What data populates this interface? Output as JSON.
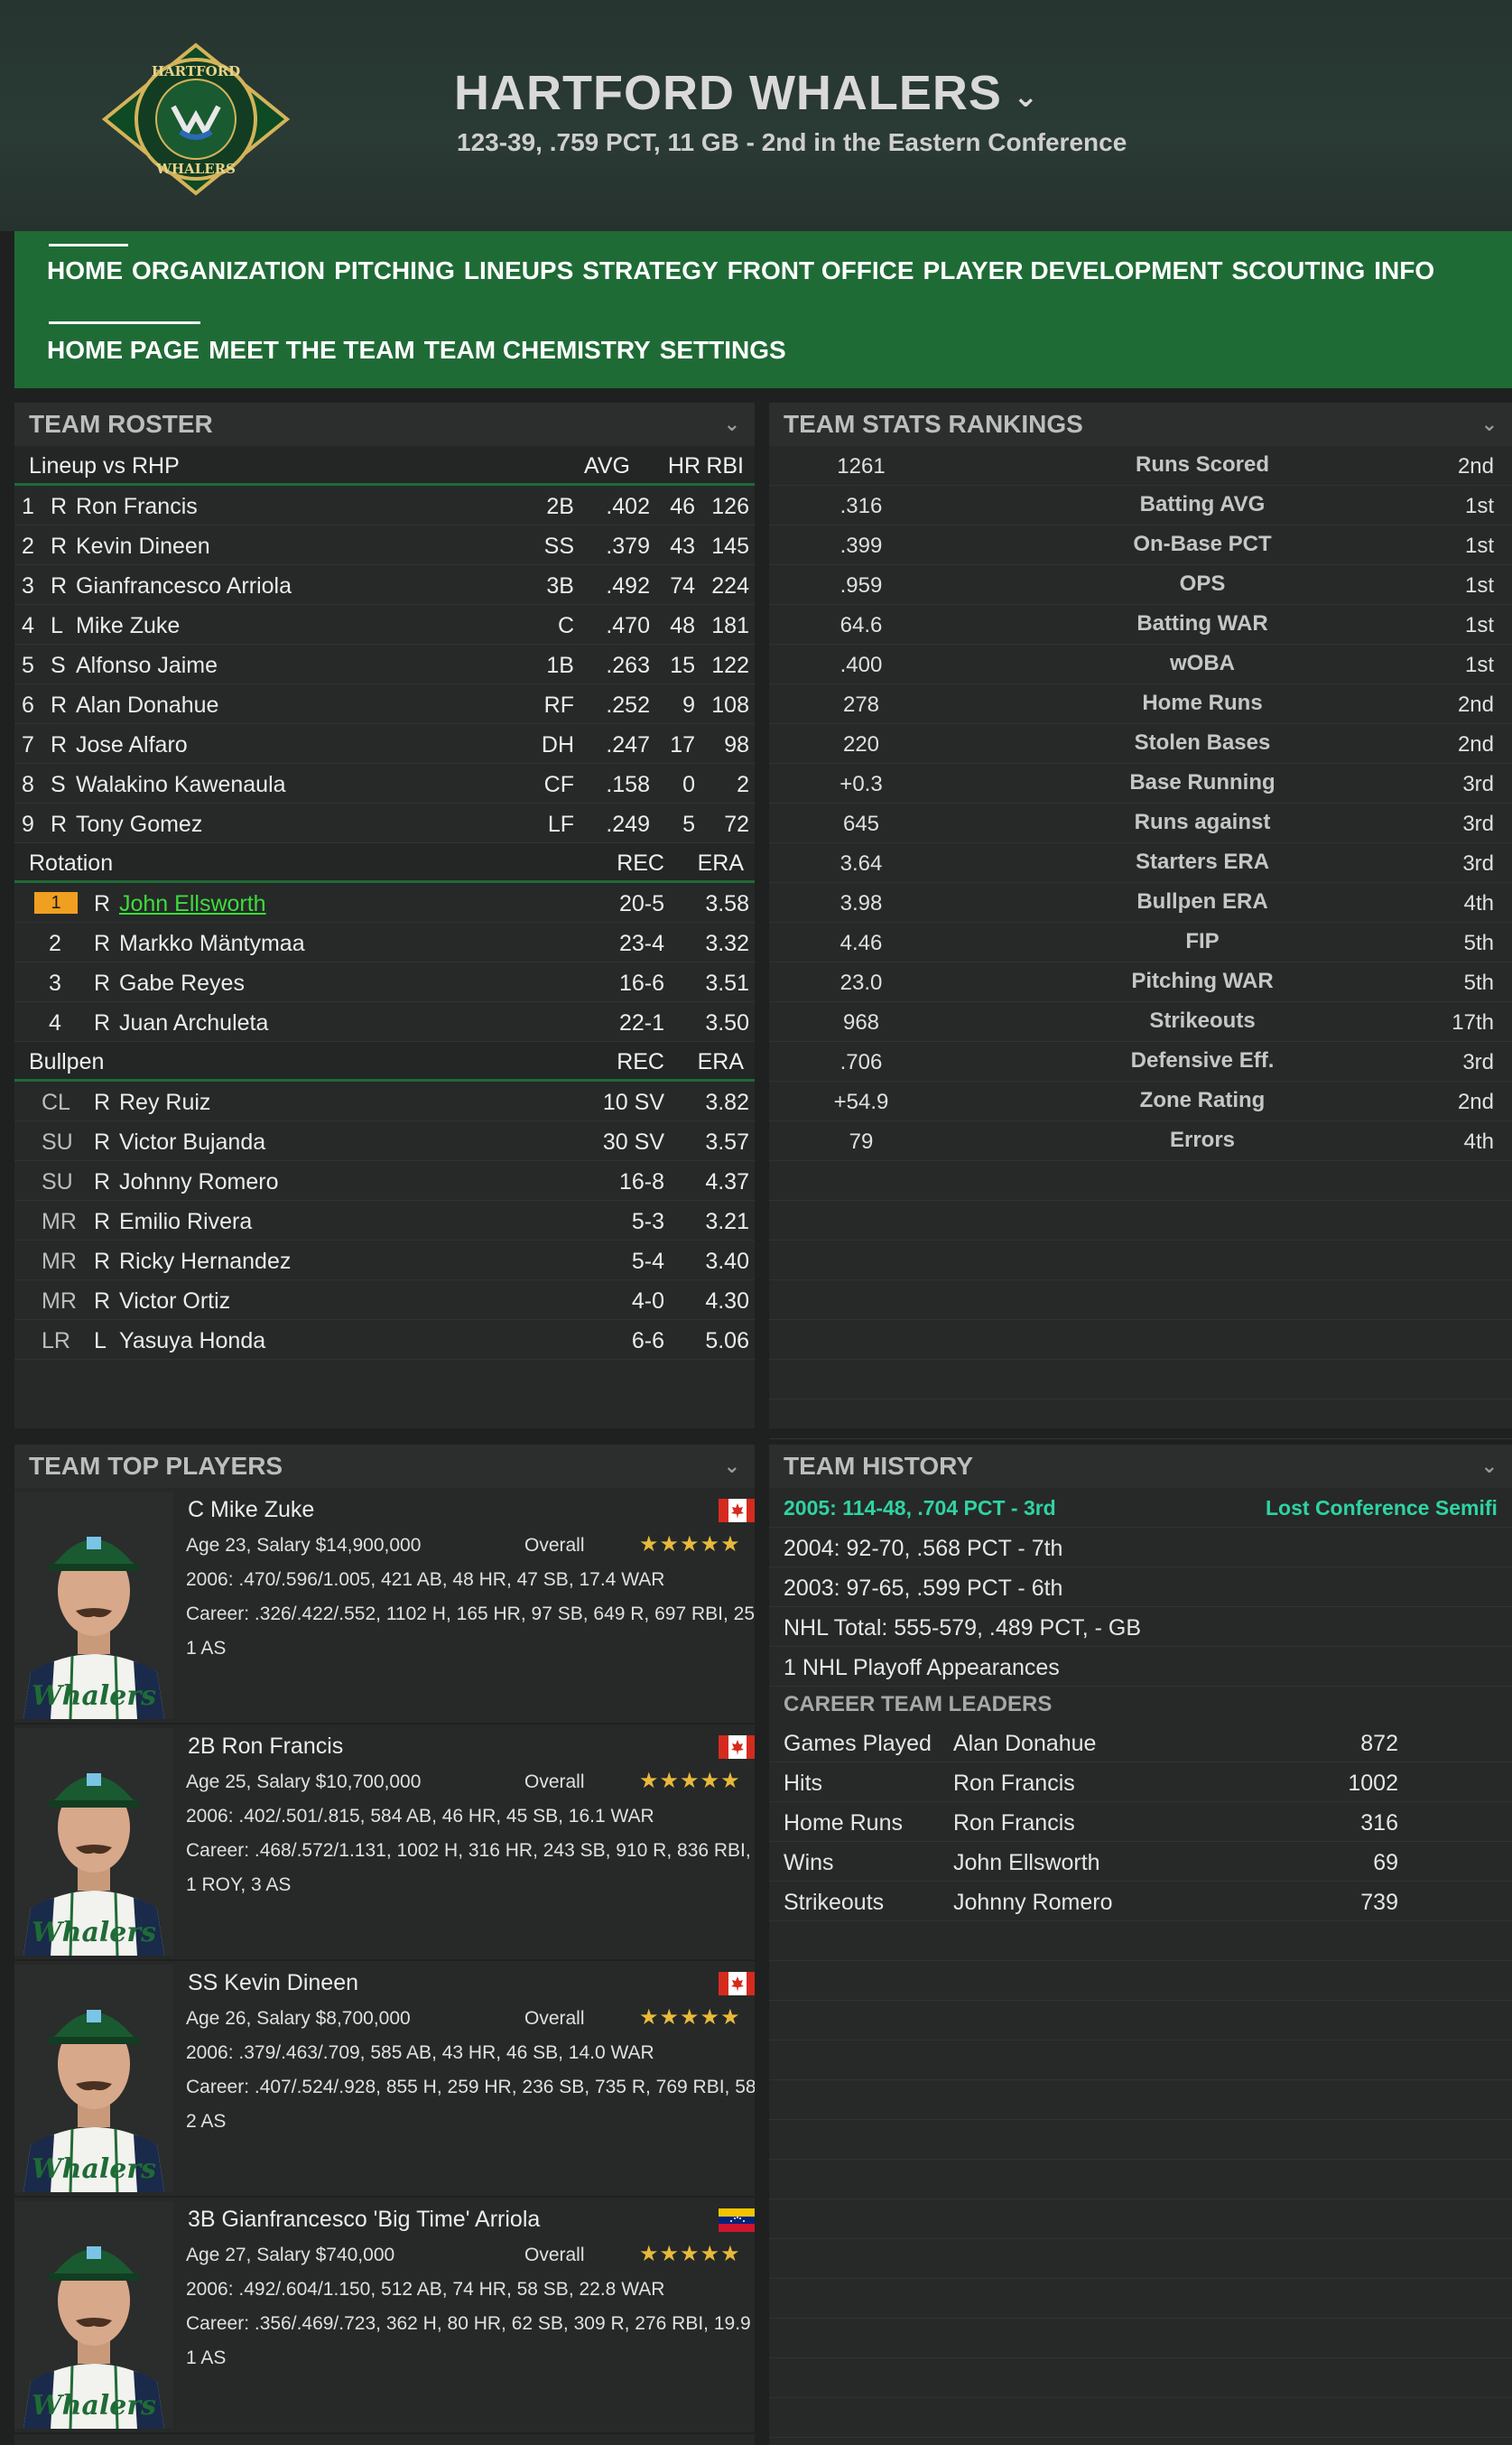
{
  "team": {
    "name": "HARTFORD WHALERS",
    "subtitle": "123-39, .759 PCT, 11 GB - 2nd in the Eastern Conference",
    "logo_text_top": "HARTFORD",
    "logo_text_bottom": "WHALERS"
  },
  "nav": {
    "main": [
      "HOME",
      "ORGANIZATION",
      "PITCHING",
      "LINEUPS",
      "STRATEGY",
      "FRONT OFFICE",
      "PLAYER DEVELOPMENT",
      "SCOUTING",
      "INFO"
    ],
    "sub": [
      "HOME PAGE",
      "MEET THE TEAM",
      "TEAM CHEMISTRY",
      "SETTINGS"
    ]
  },
  "roster": {
    "title": "TEAM ROSTER",
    "lineup_header": {
      "label": "Lineup vs RHP",
      "avg": "AVG",
      "hr": "HR",
      "rbi": "RBI"
    },
    "lineup": [
      {
        "n": "1",
        "hand": "R",
        "name": "Ron Francis",
        "pos": "2B",
        "avg": ".402",
        "hr": "46",
        "rbi": "126"
      },
      {
        "n": "2",
        "hand": "R",
        "name": "Kevin Dineen",
        "pos": "SS",
        "avg": ".379",
        "hr": "43",
        "rbi": "145"
      },
      {
        "n": "3",
        "hand": "R",
        "name": "Gianfrancesco Arriola",
        "pos": "3B",
        "avg": ".492",
        "hr": "74",
        "rbi": "224"
      },
      {
        "n": "4",
        "hand": "L",
        "name": "Mike Zuke",
        "pos": "C",
        "avg": ".470",
        "hr": "48",
        "rbi": "181"
      },
      {
        "n": "5",
        "hand": "S",
        "name": "Alfonso Jaime",
        "pos": "1B",
        "avg": ".263",
        "hr": "15",
        "rbi": "122"
      },
      {
        "n": "6",
        "hand": "R",
        "name": "Alan Donahue",
        "pos": "RF",
        "avg": ".252",
        "hr": "9",
        "rbi": "108"
      },
      {
        "n": "7",
        "hand": "R",
        "name": "Jose Alfaro",
        "pos": "DH",
        "avg": ".247",
        "hr": "17",
        "rbi": "98"
      },
      {
        "n": "8",
        "hand": "S",
        "name": "Walakino Kawenaula",
        "pos": "CF",
        "avg": ".158",
        "hr": "0",
        "rbi": "2"
      },
      {
        "n": "9",
        "hand": "R",
        "name": "Tony Gomez",
        "pos": "LF",
        "avg": ".249",
        "hr": "5",
        "rbi": "72"
      }
    ],
    "rotation_header": {
      "label": "Rotation",
      "rec": "REC",
      "era": "ERA"
    },
    "rotation": [
      {
        "n": "1",
        "hand": "R",
        "name": "John Ellsworth",
        "rec": "20-5",
        "era": "3.58",
        "highlight": true
      },
      {
        "n": "2",
        "hand": "R",
        "name": "Markko Mäntymaa",
        "rec": "23-4",
        "era": "3.32"
      },
      {
        "n": "3",
        "hand": "R",
        "name": "Gabe Reyes",
        "rec": "16-6",
        "era": "3.51"
      },
      {
        "n": "4",
        "hand": "R",
        "name": "Juan Archuleta",
        "rec": "22-1",
        "era": "3.50"
      }
    ],
    "bullpen_header": {
      "label": "Bullpen",
      "rec": "REC",
      "era": "ERA"
    },
    "bullpen": [
      {
        "role": "CL",
        "hand": "R",
        "name": "Rey Ruiz",
        "rec": "10 SV",
        "era": "3.82"
      },
      {
        "role": "SU",
        "hand": "R",
        "name": "Victor Bujanda",
        "rec": "30 SV",
        "era": "3.57"
      },
      {
        "role": "SU",
        "hand": "R",
        "name": "Johnny Romero",
        "rec": "16-8",
        "era": "4.37"
      },
      {
        "role": "MR",
        "hand": "R",
        "name": "Emilio Rivera",
        "rec": "5-3",
        "era": "3.21"
      },
      {
        "role": "MR",
        "hand": "R",
        "name": "Ricky Hernandez",
        "rec": "5-4",
        "era": "3.40"
      },
      {
        "role": "MR",
        "hand": "R",
        "name": "Victor Ortiz",
        "rec": "4-0",
        "era": "4.30"
      },
      {
        "role": "LR",
        "hand": "L",
        "name": "Yasuya Honda",
        "rec": "6-6",
        "era": "5.06"
      }
    ]
  },
  "rankings": {
    "title": "TEAM STATS RANKINGS",
    "rows": [
      {
        "value": "1261",
        "label": "Runs Scored",
        "rank": "2nd"
      },
      {
        "value": ".316",
        "label": "Batting AVG",
        "rank": "1st"
      },
      {
        "value": ".399",
        "label": "On-Base PCT",
        "rank": "1st"
      },
      {
        "value": ".959",
        "label": "OPS",
        "rank": "1st"
      },
      {
        "value": "64.6",
        "label": "Batting WAR",
        "rank": "1st"
      },
      {
        "value": ".400",
        "label": "wOBA",
        "rank": "1st"
      },
      {
        "value": "278",
        "label": "Home Runs",
        "rank": "2nd"
      },
      {
        "value": "220",
        "label": "Stolen Bases",
        "rank": "2nd"
      },
      {
        "value": "+0.3",
        "label": "Base Running",
        "rank": "3rd"
      },
      {
        "value": "645",
        "label": "Runs against",
        "rank": "3rd"
      },
      {
        "value": "3.64",
        "label": "Starters ERA",
        "rank": "3rd"
      },
      {
        "value": "3.98",
        "label": "Bullpen ERA",
        "rank": "4th"
      },
      {
        "value": "4.46",
        "label": "FIP",
        "rank": "5th"
      },
      {
        "value": "23.0",
        "label": "Pitching WAR",
        "rank": "5th"
      },
      {
        "value": "968",
        "label": "Strikeouts",
        "rank": "17th"
      },
      {
        "value": ".706",
        "label": "Defensive Eff.",
        "rank": "3rd"
      },
      {
        "value": "+54.9",
        "label": "Zone Rating",
        "rank": "2nd"
      },
      {
        "value": "79",
        "label": "Errors",
        "rank": "4th"
      }
    ]
  },
  "top_players": {
    "title": "TEAM TOP PLAYERS",
    "overall_label": "Overall",
    "stars": "★★★★★",
    "players": [
      {
        "name": "C Mike Zuke",
        "age_salary": "Age 23, Salary $14,900,000",
        "season": "2006: .470/.596/1.005, 421 AB, 48 HR, 47 SB, 17.4 WAR",
        "career": "Career: .326/.422/.552, 1102 H, 165 HR, 97 SB, 649 R, 697 RBI, 25",
        "awards": "1 AS",
        "flag": "canada"
      },
      {
        "name": "2B Ron Francis",
        "age_salary": "Age 25, Salary $10,700,000",
        "season": "2006: .402/.501/.815, 584 AB, 46 HR, 45 SB, 16.1 WAR",
        "career": "Career: .468/.572/1.131, 1002 H, 316 HR, 243 SB, 910 R, 836 RBI,",
        "awards": "1 ROY, 3 AS",
        "flag": "canada"
      },
      {
        "name": "SS Kevin Dineen",
        "age_salary": "Age 26, Salary $8,700,000",
        "season": "2006: .379/.463/.709, 585 AB, 43 HR, 46 SB, 14.0 WAR",
        "career": "Career: .407/.524/.928, 855 H, 259 HR, 236 SB, 735 R, 769 RBI, 58",
        "awards": "2 AS",
        "flag": "canada"
      },
      {
        "name": "3B Gianfrancesco 'Big Time' Arriola",
        "age_salary": "Age 27, Salary $740,000",
        "season": "2006: .492/.604/1.150, 512 AB, 74 HR, 58 SB, 22.8 WAR",
        "career": "Career: .356/.469/.723, 362 H, 80 HR, 62 SB, 309 R, 276 RBI, 19.9",
        "awards": "1 AS",
        "flag": "venezuela"
      }
    ]
  },
  "history": {
    "title": "TEAM HISTORY",
    "seasons": [
      {
        "text": "2005: 114-48, .704 PCT - 3rd",
        "result": "Lost Conference Semifi",
        "highlight": true
      },
      {
        "text": "2004: 92-70, .568 PCT - 7th"
      },
      {
        "text": "2003: 97-65, .599 PCT - 6th"
      },
      {
        "text": "NHL Total: 555-579, .489 PCT, - GB"
      },
      {
        "text": "1 NHL Playoff Appearances"
      }
    ],
    "leaders_title": "CAREER TEAM LEADERS",
    "leaders": [
      {
        "cat": "Games Played",
        "player": "Alan Donahue",
        "value": "872"
      },
      {
        "cat": "Hits",
        "player": "Ron Francis",
        "value": "1002"
      },
      {
        "cat": "Home Runs",
        "player": "Ron Francis",
        "value": "316"
      },
      {
        "cat": "Wins",
        "player": "John Ellsworth",
        "value": "69"
      },
      {
        "cat": "Strikeouts",
        "player": "Johnny Romero",
        "value": "739"
      }
    ]
  },
  "colors": {
    "accent_green": "#1f6b36",
    "link_green": "#3ddc3d",
    "teal": "#2fd3a3",
    "star": "#e8b93a",
    "badge_orange": "#f0a020"
  }
}
